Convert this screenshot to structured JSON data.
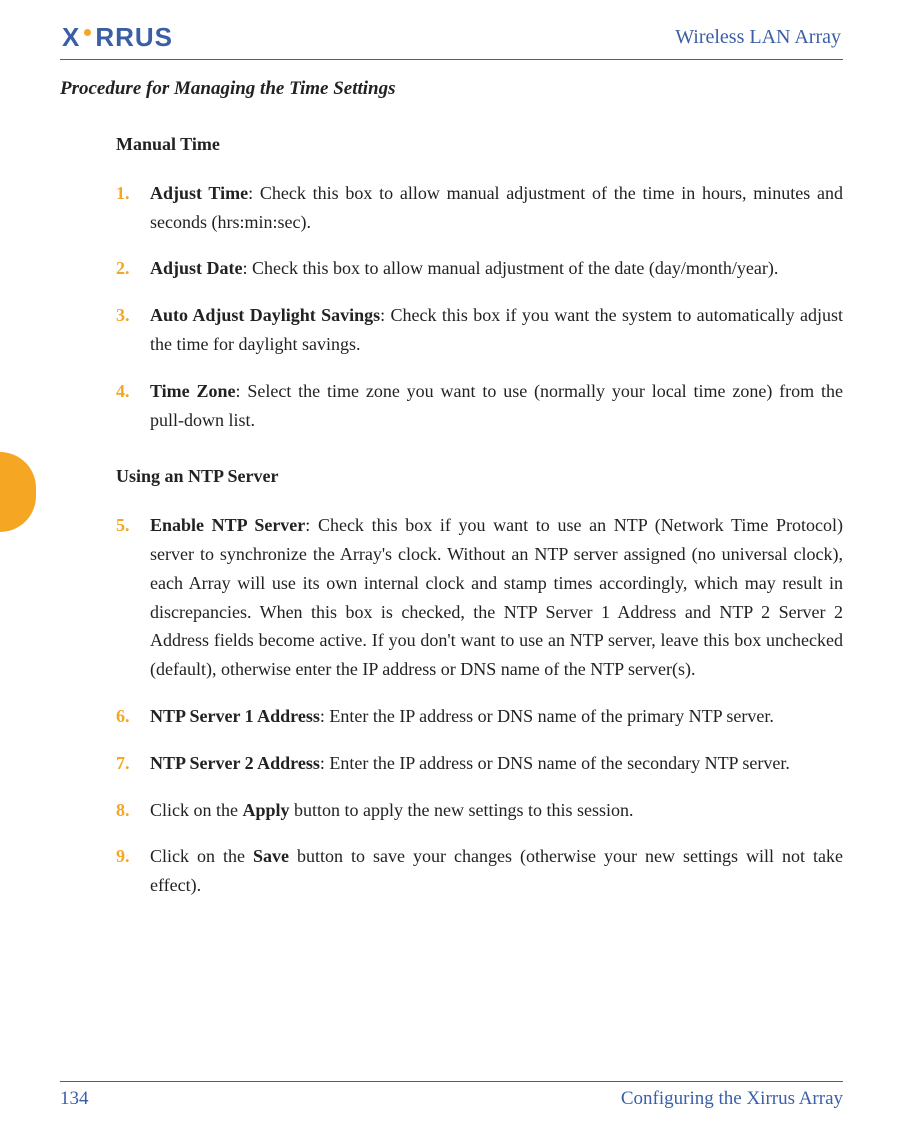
{
  "header": {
    "logo_left": "X",
    "logo_right": "RRUS",
    "right_text": "Wireless LAN Array"
  },
  "section_title": "Procedure for Managing the Time Settings",
  "sections": [
    {
      "heading": "Manual Time",
      "items": [
        {
          "num": "1.",
          "bold": "Adjust Time",
          "rest": ": Check this box to allow manual adjustment of the time in hours, minutes and seconds (hrs:min:sec)."
        },
        {
          "num": "2.",
          "bold": "Adjust Date",
          "rest": ": Check this box to allow manual adjustment of the date (day/month/year)."
        },
        {
          "num": "3.",
          "bold": "Auto Adjust Daylight Savings",
          "rest": ": Check this box if you want the system to automatically adjust the time for daylight savings."
        },
        {
          "num": "4.",
          "bold": "Time Zone",
          "rest": ": Select the time zone you want to use (normally your local time zone) from the pull-down list."
        }
      ]
    },
    {
      "heading": "Using an NTP Server",
      "items": [
        {
          "num": "5.",
          "bold": "Enable NTP Server",
          "rest": ": Check this box if you want to use an NTP (Network Time Protocol) server to synchronize the Array's clock. Without an NTP server assigned (no universal clock), each Array will use its own internal clock and stamp times accordingly, which may result in discrepancies. When this box is checked, the NTP Server 1 Address and NTP 2 Server 2 Address fields become active. If you don't want to use an NTP server, leave this box unchecked (default), otherwise enter the IP address or DNS name of the NTP server(s)."
        },
        {
          "num": "6.",
          "bold": "NTP Server 1 Address",
          "rest": ": Enter the IP address or DNS name of the primary NTP server."
        },
        {
          "num": "7.",
          "bold": "NTP Server 2 Address",
          "rest": ": Enter the IP address or DNS name of the secondary NTP server."
        },
        {
          "num": "8.",
          "bold": "",
          "rest_pre": "Click on the ",
          "bold2": "Apply",
          "rest2": " button to apply the new settings to this session."
        },
        {
          "num": "9.",
          "bold": "",
          "rest_pre": "Click on the ",
          "bold2": "Save",
          "rest2": " button to save your changes (otherwise your new settings will not take effect)."
        }
      ]
    }
  ],
  "footer": {
    "page_num": "134",
    "right_text": "Configuring the Xirrus Array"
  }
}
